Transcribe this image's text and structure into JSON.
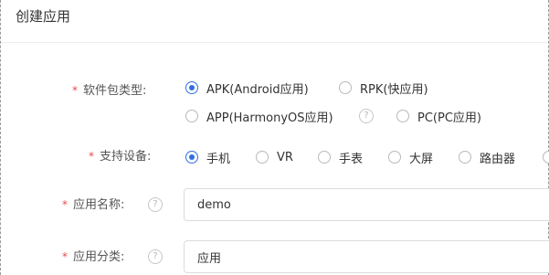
{
  "page": {
    "title": "创建应用"
  },
  "form": {
    "package_type": {
      "required_mark": "*",
      "label": "软件包类型:",
      "options": [
        {
          "label": "APK(Android应用)",
          "selected": true
        },
        {
          "label": "RPK(快应用)",
          "selected": false
        },
        {
          "label": "APP(HarmonyOS应用)",
          "selected": false,
          "help_icon": "question-circle-icon"
        },
        {
          "label": "PC(PC应用)",
          "selected": false
        }
      ]
    },
    "devices": {
      "required_mark": "*",
      "label": "支持设备:",
      "options": [
        {
          "label": "手机",
          "selected": true
        },
        {
          "label": "VR",
          "selected": false
        },
        {
          "label": "手表",
          "selected": false
        },
        {
          "label": "大屏",
          "selected": false
        },
        {
          "label": "路由器",
          "selected": false
        },
        {
          "label": "",
          "selected": false
        }
      ]
    },
    "app_name": {
      "required_mark": "*",
      "label": "应用名称:",
      "help_icon": "question-circle-icon",
      "value": "demo"
    },
    "app_category": {
      "required_mark": "*",
      "label": "应用分类:",
      "help_icon": "question-circle-icon",
      "value": "应用"
    }
  },
  "colors": {
    "accent": "#2f6fe0",
    "required": "#e84a4a"
  },
  "icons": {
    "help_glyph": "?"
  }
}
